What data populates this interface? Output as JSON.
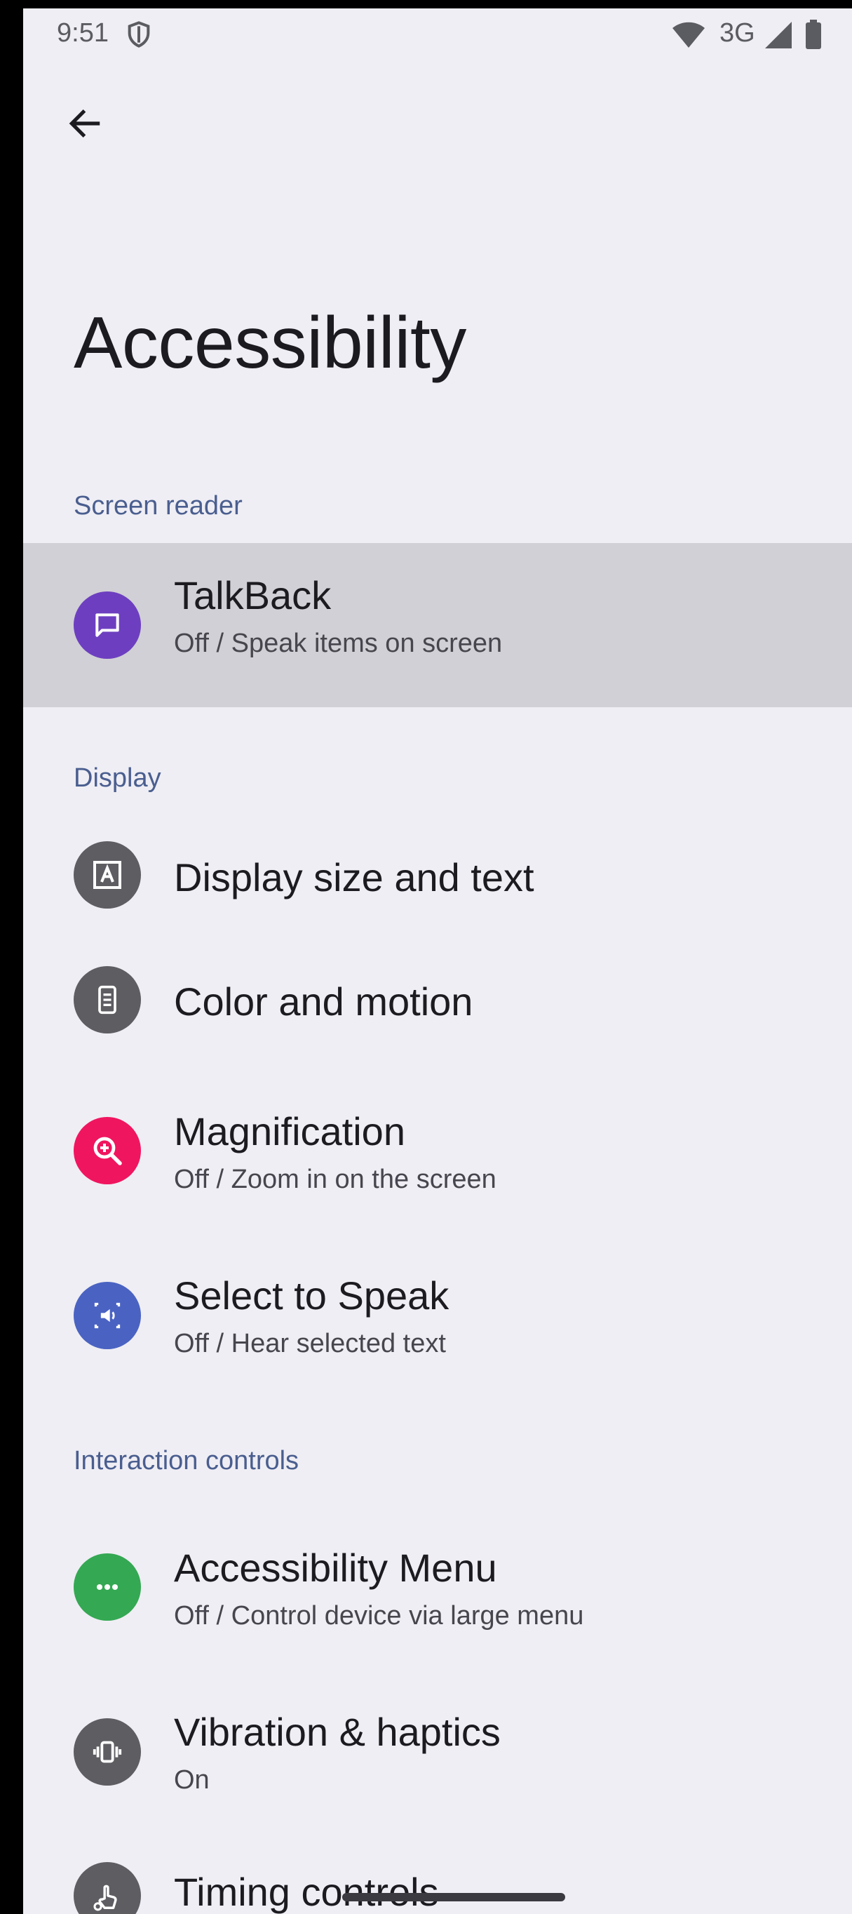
{
  "status_bar": {
    "time": "9:51",
    "network": "3G"
  },
  "header": {
    "title": "Accessibility"
  },
  "sections": {
    "screen_reader": "Screen reader",
    "display": "Display",
    "interaction": "Interaction controls"
  },
  "items": {
    "talkback": {
      "title": "TalkBack",
      "subtitle": "Off / Speak items on screen",
      "icon_color": "#6d3fc0"
    },
    "display_size": {
      "title": "Display size and text",
      "icon_color": "#5d5d62"
    },
    "color_motion": {
      "title": "Color and motion",
      "icon_color": "#5d5d62"
    },
    "magnification": {
      "title": "Magnification",
      "subtitle": "Off / Zoom in on the screen",
      "icon_color": "#f0155f"
    },
    "select_to_speak": {
      "title": "Select to Speak",
      "subtitle": "Off / Hear selected text",
      "icon_color": "#4a63c2"
    },
    "accessibility_menu": {
      "title": "Accessibility Menu",
      "subtitle": "Off / Control device via large menu",
      "icon_color": "#34a853"
    },
    "vibration": {
      "title": "Vibration & haptics",
      "subtitle": "On",
      "icon_color": "#5d5d62"
    },
    "timing": {
      "title": "Timing controls",
      "icon_color": "#5d5d62"
    }
  },
  "colors": {
    "background": "#efeef4",
    "section_header": "#4a5e8f",
    "highlight_row": "#d1d0d6"
  }
}
